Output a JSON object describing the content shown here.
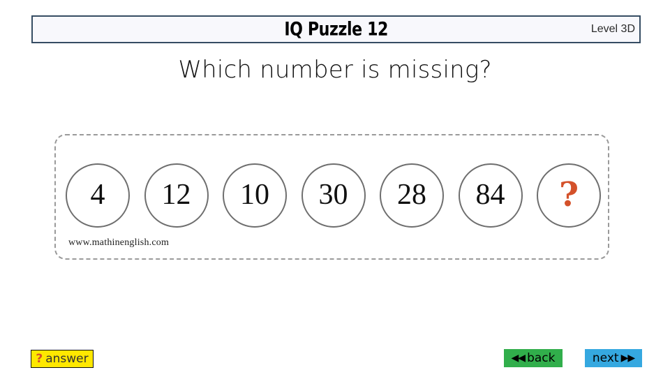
{
  "header": {
    "title": "IQ Puzzle 12",
    "level_label": "Level 3D",
    "border_color": "#364d63",
    "background_color": "#f8f8fc"
  },
  "question": {
    "text": "Which number is missing?"
  },
  "puzzle": {
    "border_style": "dashed",
    "border_color": "#9a9a9a",
    "circles": [
      {
        "value": "4",
        "unknown": false
      },
      {
        "value": "12",
        "unknown": false
      },
      {
        "value": "10",
        "unknown": false
      },
      {
        "value": "30",
        "unknown": false
      },
      {
        "value": "28",
        "unknown": false
      },
      {
        "value": "84",
        "unknown": false
      },
      {
        "value": "?",
        "unknown": true
      }
    ],
    "unknown_color": "#d4512a",
    "watermark": "www.mathinenglish.com"
  },
  "footer": {
    "answer": {
      "marker": "?",
      "label": "answer",
      "background_color": "#ffe800",
      "marker_color": "#d4512a"
    },
    "back": {
      "arrows": "◀◀",
      "label": "back",
      "background_color": "#31ae4b"
    },
    "next": {
      "label": "next",
      "arrows": "▶▶",
      "background_color": "#35a8e0"
    }
  }
}
